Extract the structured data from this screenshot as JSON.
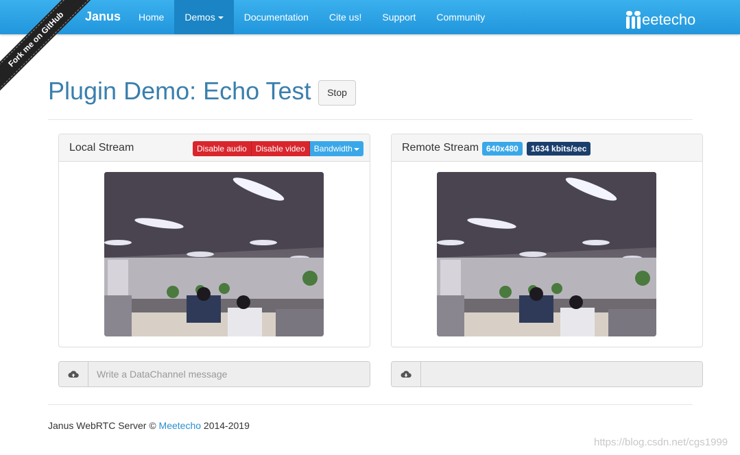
{
  "navbar": {
    "brand": "Janus",
    "items": [
      {
        "label": "Home",
        "active": false
      },
      {
        "label": "Demos",
        "active": true,
        "dropdown": true
      },
      {
        "label": "Documentation",
        "active": false
      },
      {
        "label": "Cite us!",
        "active": false
      },
      {
        "label": "Support",
        "active": false
      },
      {
        "label": "Community",
        "active": false
      }
    ],
    "logo_text": "eetecho",
    "logo_mark": "M"
  },
  "ribbon": {
    "label": "Fork me on GitHub"
  },
  "header": {
    "title": "Plugin Demo: Echo Test",
    "stop_label": "Stop"
  },
  "local": {
    "title": "Local Stream",
    "disable_audio": "Disable audio",
    "disable_video": "Disable video",
    "bandwidth": "Bandwidth"
  },
  "remote": {
    "title": "Remote Stream",
    "resolution": "640x480",
    "bitrate": "1634 kbits/sec"
  },
  "datachannel": {
    "send_placeholder": "Write a DataChannel message",
    "receive_value": ""
  },
  "footer": {
    "prefix": "Janus WebRTC Server © ",
    "link": "Meetecho",
    "suffix": " 2014-2019"
  },
  "watermark": "https://blog.csdn.net/cgs1999",
  "colors": {
    "navbar": "#2196dc",
    "title": "#3a7fad",
    "danger": "#d9262d",
    "info": "#3aa8e8",
    "badge_dark": "#1b3f6d"
  }
}
